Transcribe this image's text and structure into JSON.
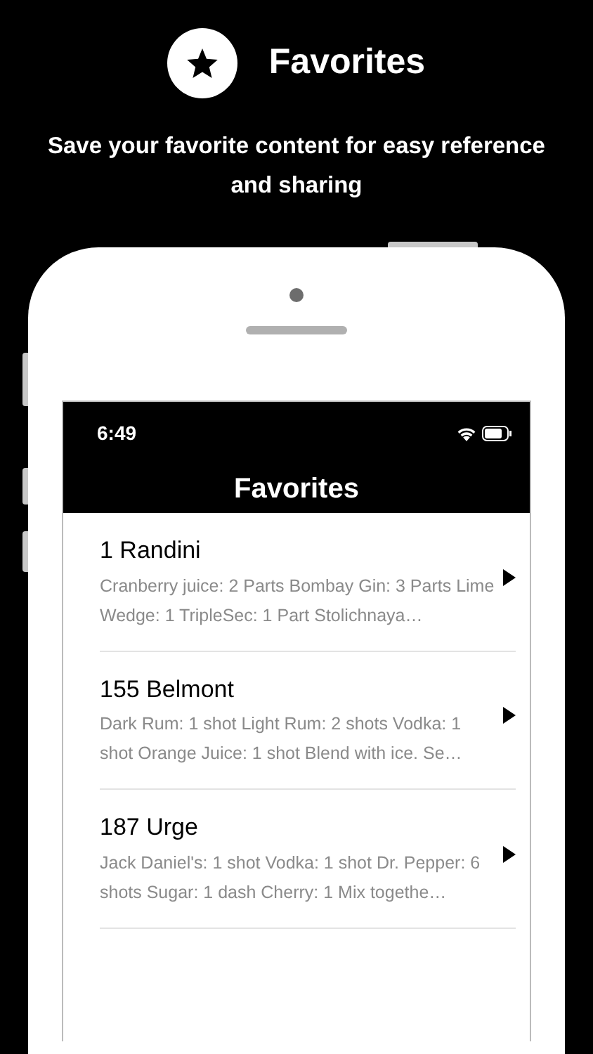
{
  "promo": {
    "title": "Favorites",
    "subtitle": "Save your favorite content for easy reference and sharing"
  },
  "status_bar": {
    "time": "6:49"
  },
  "nav_bar": {
    "title": "Favorites"
  },
  "favorites": [
    {
      "name": "1 Randini",
      "description": "Cranberry juice: 2 Parts Bombay Gin: 3 Parts Lime Wedge: 1 TripleSec: 1 Part Stolichnaya…"
    },
    {
      "name": "155 Belmont",
      "description": "Dark Rum: 1 shot Light Rum: 2 shots Vodka: 1 shot Orange Juice: 1 shot Blend with ice. Se…"
    },
    {
      "name": "187 Urge",
      "description": "Jack Daniel's: 1 shot Vodka: 1 shot Dr. Pepper: 6 shots Sugar: 1 dash Cherry: 1 Mix togethe…"
    }
  ]
}
